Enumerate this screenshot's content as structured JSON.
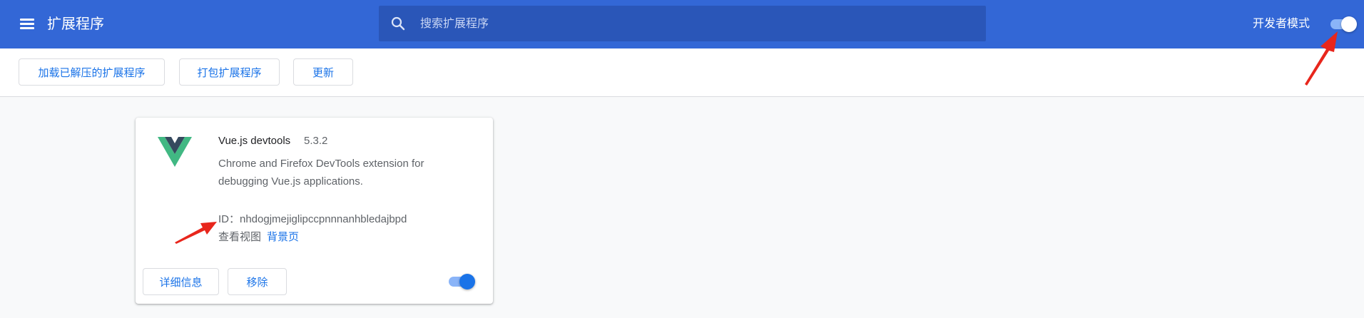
{
  "header": {
    "title": "扩展程序",
    "menu_icon": "menu-icon",
    "search": {
      "icon": "search-icon",
      "placeholder": "搜索扩展程序",
      "value": ""
    },
    "developer_mode": {
      "label": "开发者模式",
      "enabled": true
    }
  },
  "toolbar": {
    "load_unpacked_label": "加载已解压的扩展程序",
    "pack_label": "打包扩展程序",
    "update_label": "更新"
  },
  "extension": {
    "name": "Vue.js devtools",
    "version": "5.3.2",
    "description": "Chrome and Firefox DevTools extension for debugging Vue.js applications.",
    "id": "ID：nhdogjmejiglipccpnnnanhbledajbpd",
    "views_label": "查看视图",
    "background_page_label": "背景页",
    "details_label": "详细信息",
    "remove_label": "移除",
    "enabled": true,
    "logo_icon": "vue-logo-icon"
  },
  "colors": {
    "header_bg": "#3367d6",
    "search_bg": "#2a56b8",
    "accent": "#1a73e8",
    "toggle_track": "#8ab4f8",
    "page_bg": "#f8f9fa",
    "annotation_arrow": "#e8261c"
  }
}
